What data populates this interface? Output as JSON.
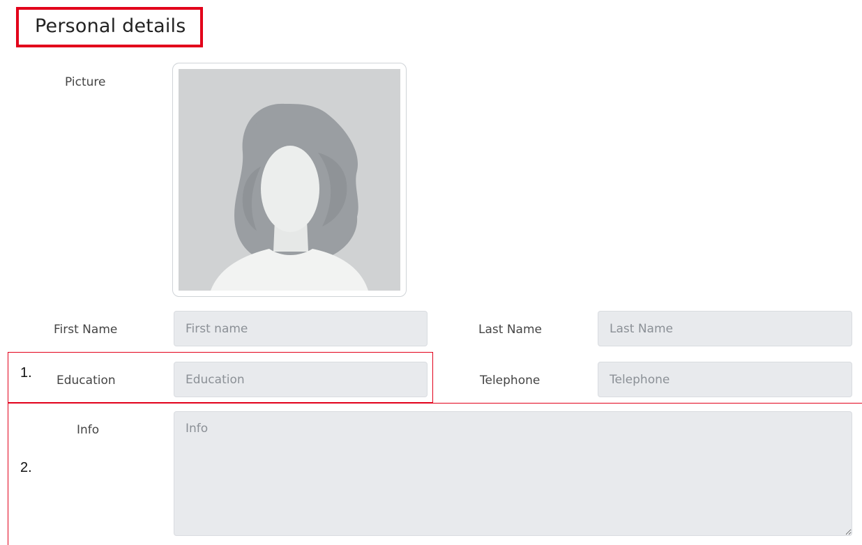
{
  "header": {
    "title": "Personal details"
  },
  "picture": {
    "label": "Picture"
  },
  "fields": {
    "first_name": {
      "label": "First Name",
      "placeholder": "First name",
      "value": ""
    },
    "last_name": {
      "label": "Last Name",
      "placeholder": "Last Name",
      "value": ""
    },
    "education": {
      "label": "Education",
      "placeholder": "Education",
      "value": ""
    },
    "telephone": {
      "label": "Telephone",
      "placeholder": "Telephone",
      "value": ""
    },
    "info": {
      "label": "Info",
      "placeholder": "Info",
      "value": ""
    }
  },
  "annotations": {
    "marker_1": "1.",
    "marker_2": "2."
  },
  "colors": {
    "annotation_red": "#e2001a",
    "field_bg": "#e8eaed",
    "avatar_bg": "#d0d2d3",
    "avatar_hair": "#9a9ea2"
  }
}
